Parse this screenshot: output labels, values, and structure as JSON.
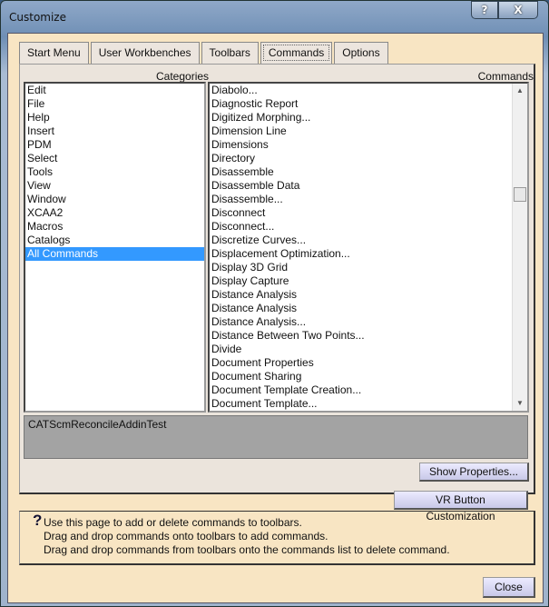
{
  "window": {
    "title": "Customize",
    "help_button": "?",
    "close_button": "X"
  },
  "tabs": [
    {
      "label": "Start Menu"
    },
    {
      "label": "User Workbenches"
    },
    {
      "label": "Toolbars"
    },
    {
      "label": "Commands",
      "active": true
    },
    {
      "label": "Options"
    }
  ],
  "categories": {
    "header": "Categories",
    "selected": "All Commands",
    "items": [
      "Edit",
      "File",
      "Help",
      "Insert",
      "PDM",
      "Select",
      "Tools",
      "View",
      "Window",
      "XCAA2",
      "Macros",
      "Catalogs",
      "All Commands"
    ]
  },
  "commands": {
    "header": "Commands",
    "items": [
      "Diabolo...",
      "Diagnostic Report",
      "Digitized Morphing...",
      "Dimension Line",
      "Dimensions",
      "Directory",
      "Disassemble",
      "Disassemble Data",
      "Disassemble...",
      "Disconnect",
      "Disconnect...",
      "Discretize Curves...",
      "Displacement Optimization...",
      "Display 3D Grid",
      "Display Capture",
      "Distance Analysis",
      "Distance Analysis",
      "Distance Analysis...",
      "Distance Between Two Points...",
      "Divide",
      "Document Properties",
      "Document Sharing",
      "Document Template Creation...",
      "Document Template..."
    ]
  },
  "description": "CATScmReconcileAddinTest",
  "buttons": {
    "show_properties": "Show Properties...",
    "vr_customization": "VR Button Customization",
    "close": "Close"
  },
  "help": {
    "icon": "question-icon",
    "lines": [
      "Use this page to add or delete commands to toolbars.",
      "Drag and drop commands onto toolbars to add commands.",
      "Drag and drop commands from toolbars onto the commands list to delete command."
    ]
  }
}
